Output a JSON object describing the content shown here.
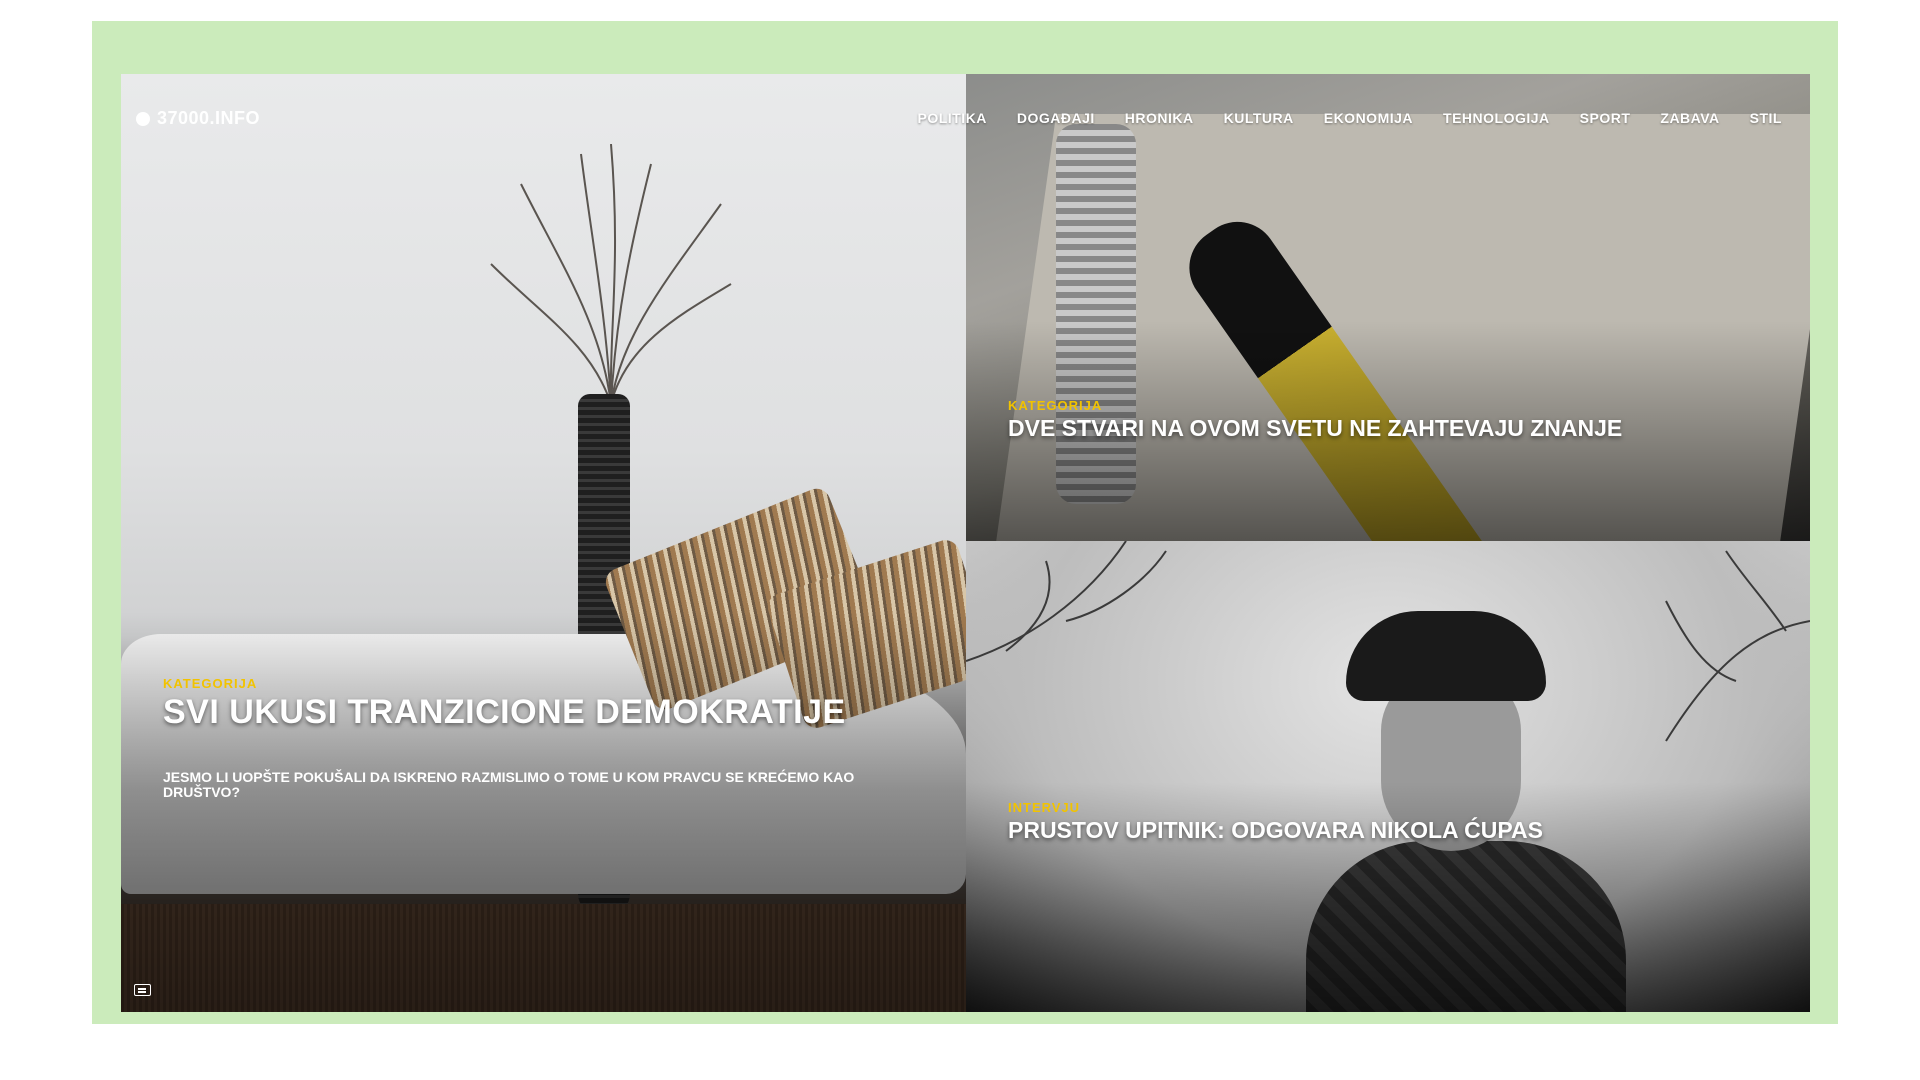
{
  "site": {
    "logo_text": "37000.INFO"
  },
  "nav": {
    "items": [
      "POLITIKA",
      "DOGAĐAJI",
      "HRONIKA",
      "KULTURA",
      "EKONOMIJA",
      "TEHNOLOGIJA",
      "SPORT",
      "ZABAVA",
      "STIL"
    ]
  },
  "articles": {
    "featured": {
      "category": "KATEGORIJA",
      "title": "SVI UKUSI TRANZICIONE DEMOKRATIJE",
      "description": "JESMO LI UOPŠTE POKUŠALI DA ISKRENO RAZMISLIMO O TOME U KOM PRAVCU SE KREĆEMO KAO DRUŠTVO?"
    },
    "top_right": {
      "category": "KATEGORIJA",
      "title": "DVE STVARI NA OVOM SVETU NE ZAHTEVAJU ZNANJE"
    },
    "bottom_right": {
      "category": "INTERVJU",
      "title": "PRUSTOV UPITNIK: ODGOVARA NIKOLA ĆUPAS"
    }
  },
  "colors": {
    "frame_bg": "#cbebbb",
    "category_accent": "#f2c300",
    "text": "#ffffff"
  },
  "icons": {
    "caption_icon": "closed-captions-icon"
  }
}
